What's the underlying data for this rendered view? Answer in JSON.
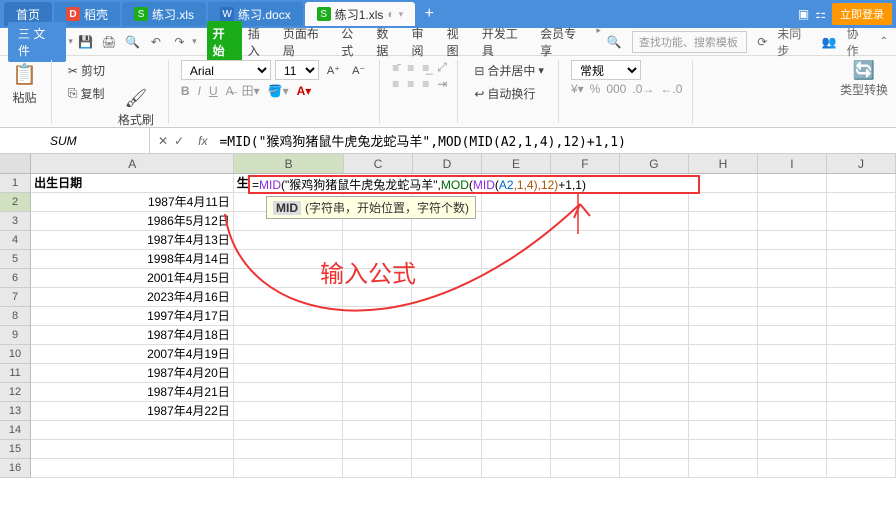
{
  "tabs": {
    "home": "首页",
    "daoke": "稻壳",
    "t1": "练习.xls",
    "t2": "练习.docx",
    "t3": "练习1.xls"
  },
  "login": "立即登录",
  "menu": {
    "file": "三 文件",
    "start": "开始",
    "insert": "插入",
    "layout": "页面布局",
    "formula": "公式",
    "data": "数据",
    "review": "审阅",
    "view": "视图",
    "dev": "开发工具",
    "member": "会员专享",
    "search": "查找功能、搜索模板",
    "sync": "未同步",
    "coop": "协作"
  },
  "ribbon": {
    "cut": "剪切",
    "copy": "复制",
    "paste": "粘贴",
    "fmtpaint": "格式刷",
    "font": "Arial",
    "size": "11",
    "merge": "合并居中",
    "wrap": "自动换行",
    "general": "常规",
    "typecvt": "类型转换"
  },
  "fx": {
    "name": "SUM",
    "formula": "=MID(\"猴鸡狗猪鼠牛虎兔龙蛇马羊\",MOD(MID(A2,1,4),12)+1,1)"
  },
  "headers": {
    "A": "出生日期",
    "B": "生肖"
  },
  "dates": [
    "1987年4月11日",
    "1986年5月12日",
    "1987年4月13日",
    "1998年4月14日",
    "2001年4月15日",
    "2023年4月16日",
    "1997年4月17日",
    "1987年4月18日",
    "2007年4月19日",
    "1987年4月20日",
    "1987年4月21日",
    "1987年4月22日"
  ],
  "cellFormula": {
    "prefix": "=",
    "fn1": "MID",
    "str": "(\"猴鸡狗猪鼠牛虎兔龙蛇马羊\",",
    "fn2": "MOD",
    "l2": "(",
    "fn3": "MID",
    "l3": "(",
    "a2": "A2",
    "c1": ",1,4)",
    "c2": ",12)",
    "c3": "+1,1)"
  },
  "tooltip": {
    "label": "MID",
    "body": "(字符串，开始位置，字符个数)"
  },
  "annotation": "输入公式",
  "cols": [
    "A",
    "B",
    "C",
    "D",
    "E",
    "F",
    "G",
    "H",
    "I",
    "J"
  ]
}
